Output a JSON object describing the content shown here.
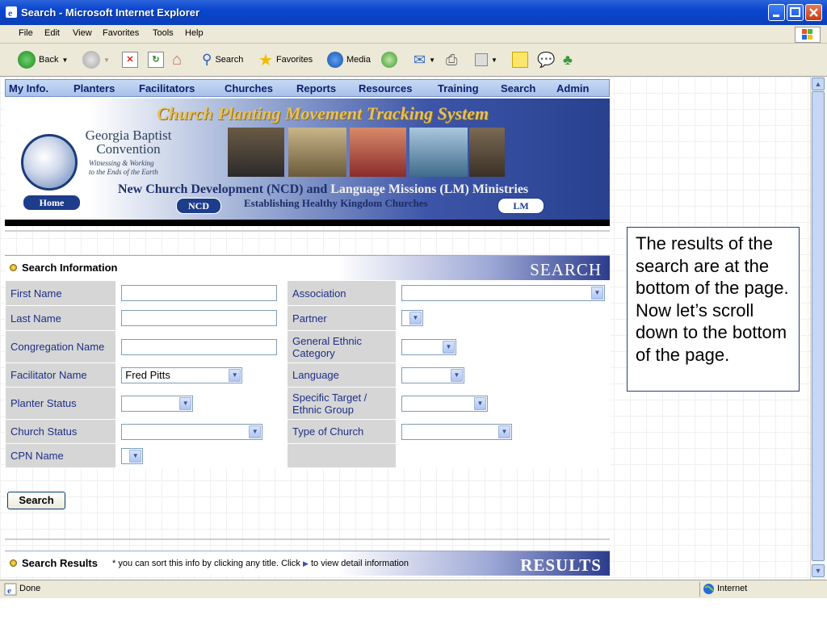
{
  "window": {
    "title": "Search - Microsoft Internet Explorer",
    "menu": [
      "File",
      "Edit",
      "View",
      "Favorites",
      "Tools",
      "Help"
    ]
  },
  "toolbar": {
    "back": "Back",
    "search": "Search",
    "favorites": "Favorites",
    "media": "Media"
  },
  "site_nav": [
    "My Info.",
    "Planters",
    "Facilitators",
    "Churches",
    "Reports",
    "Resources",
    "Training",
    "Search",
    "Admin"
  ],
  "banner": {
    "headline": "Church Planting Movement Tracking System",
    "org_line1": "Georgia Baptist",
    "org_line2": "Convention",
    "tagline1": "Witnessing & Working",
    "tagline2": "to the Ends of the Earth",
    "sub1_a": "New Church Development (NCD) and ",
    "sub1_b": "Language Missions (LM) Ministries",
    "sub2": "Establishing Healthy Kingdom Churches",
    "home": "Home",
    "ncd": "NCD",
    "lm": "LM"
  },
  "search_section": {
    "title": "Search Information",
    "graphic": "SEARCH",
    "left_fields": [
      {
        "label": "First Name",
        "type": "text",
        "value": ""
      },
      {
        "label": "Last Name",
        "type": "text",
        "value": ""
      },
      {
        "label": "Congregation Name",
        "type": "text",
        "value": ""
      },
      {
        "label": "Facilitator Name",
        "type": "select",
        "value": "Fred Pitts"
      },
      {
        "label": "Planter Status",
        "type": "select",
        "value": ""
      },
      {
        "label": "Church Status",
        "type": "select",
        "value": ""
      },
      {
        "label": "CPN Name",
        "type": "select",
        "value": ""
      }
    ],
    "right_fields": [
      {
        "label": "Association",
        "type": "select",
        "value": ""
      },
      {
        "label": "Partner",
        "type": "select",
        "value": ""
      },
      {
        "label": "General Ethnic Category",
        "type": "select",
        "value": ""
      },
      {
        "label": "Language",
        "type": "select",
        "value": ""
      },
      {
        "label": "Specific Target / Ethnic Group",
        "type": "select",
        "value": ""
      },
      {
        "label": "Type of Church",
        "type": "select",
        "value": ""
      }
    ],
    "search_button": "Search"
  },
  "results_section": {
    "title": "Search Results",
    "note_a": "* you can sort this info by clicking any title. Click",
    "note_b": "to view detail information",
    "graphic": "RESULTS"
  },
  "callout": {
    "text": "The results of the search are at the bottom of the page.  Now let’s scroll down to the bottom of the page."
  },
  "status": {
    "text": "Done",
    "zone": "Internet"
  },
  "colors": {
    "title_bar": "#0a46d0",
    "label_bg": "#d6d6d6",
    "label_text": "#1f2e86",
    "banner_dark": "#27418f",
    "headline_gold": "#e6c15c"
  }
}
